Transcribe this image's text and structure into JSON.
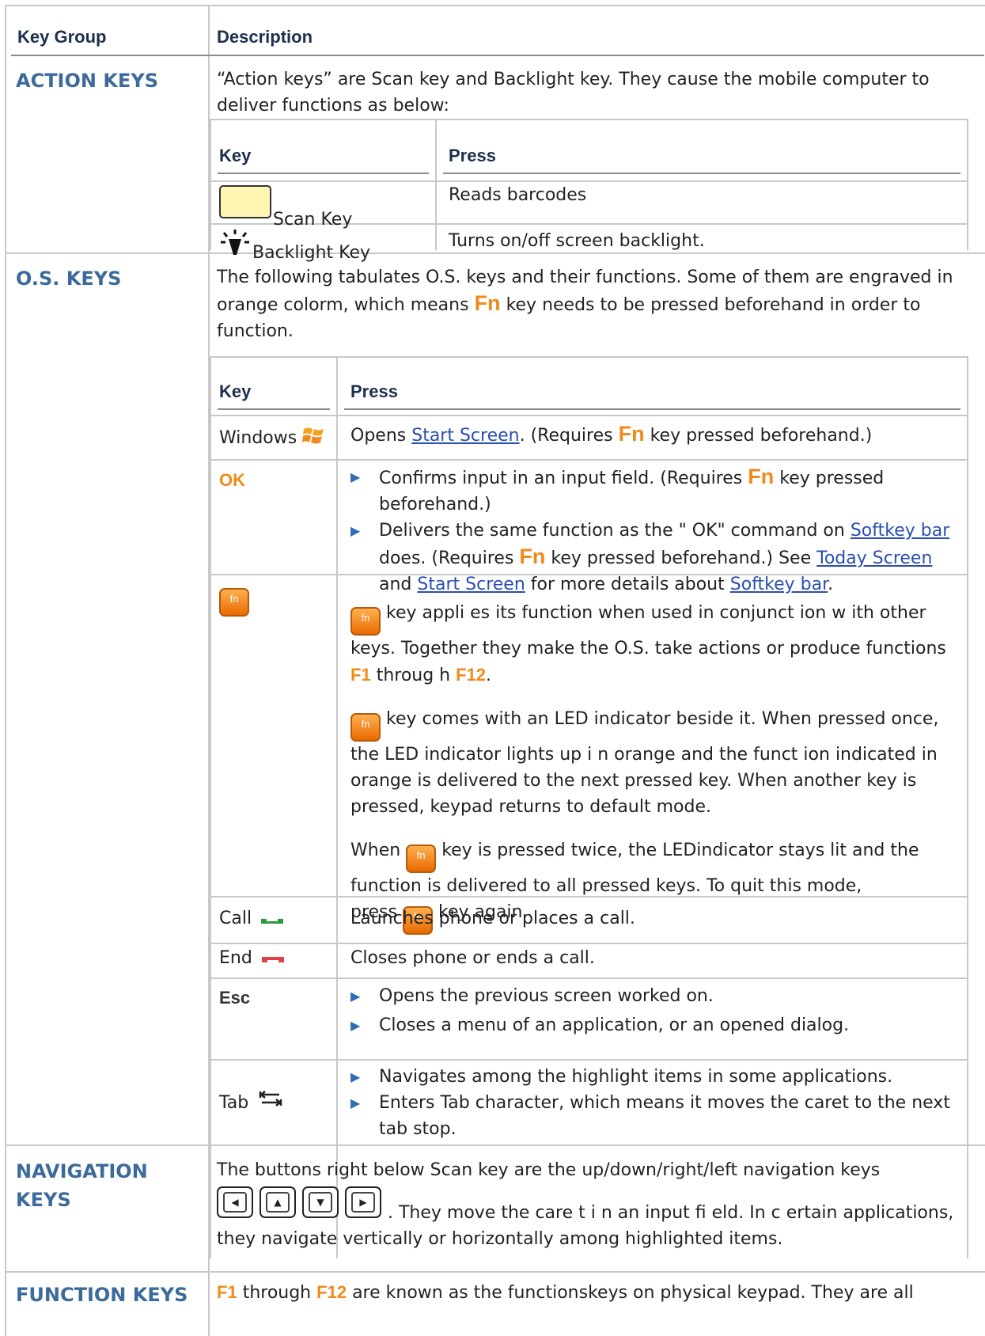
{
  "header": {
    "key_group": "Key Group",
    "description": "Description"
  },
  "inner_header": {
    "key": "Key",
    "press": "Press"
  },
  "action": {
    "group": "ACTION KEYS",
    "intro": "“Action keys” are Scan key and Backlight key. They cause the mobile computer to deliver functions as below:",
    "rows": [
      {
        "key": "Scan Key",
        "press": "Reads barcodes"
      },
      {
        "key": "Backlight Key",
        "press": "Turns on/off screen backlight."
      }
    ]
  },
  "os": {
    "group": "O.S. KEYS",
    "intro_a": "The following tabulates O.S. keys and their functions. Some of them are engraved in orange colorm, which means",
    "fn": "Fn",
    "intro_b": "key needs to be pressed beforehand in order to function.",
    "windows_key": "Windows",
    "windows_a": "Opens",
    "start_screen": "Start Screen",
    "windows_b": ". (Requires",
    "windows_c": "key pressed beforehand.)",
    "ok_key": "OK",
    "ok_b1_a": "Confirms input in an input field. (Requires",
    "ok_b1_b": "key pressed beforehand.)",
    "ok_b2_a": "Delivers the same function as the \"    OK\" command on",
    "softkey_bar": "Softkey bar",
    "ok_b2_b": "does. (Requires",
    "ok_b2_c": "key pressed beforehand.) See",
    "today_screen": "Today Screen",
    "and": "and",
    "ok_b2_d": "for more details about",
    "period": ".",
    "fn_icon": "fn",
    "fn_p1_a": "key appli es its function when used in conjunct ion w ith other keys. Together they make the   O.S. take  actions or produce functions",
    "f1": "F1",
    "through": "throug h",
    "f12": "F12",
    "fn_p2": "key comes with an LED indicator beside it. When pressed once, the LED  indicator lights up i n orange and the funct ion indicated in orange is delivered to the next pressed key. When another key is pressed, keypad returns to default mode.",
    "fn_p3_a": "When",
    "fn_p3_b": "key is pressed twice, the LEDindicator stays lit and the function is delivered to all pressed keys. To quit this mode,",
    "fn_p3_c": "press",
    "fn_p3_d": "key again",
    "call_key": "Call",
    "call_press": "Launches phone or places a call.",
    "end_key": "End",
    "end_press": "Closes phone or ends a call.",
    "esc_key": "Esc",
    "esc_b1": "Opens the previous screen worked on.",
    "esc_b2": "Closes a menu of an application, or an opened dialog.",
    "tab_key": "Tab",
    "tab_b1": "Navigates among the highlight items in some applications.",
    "tab_b2": "Enters Tab character, which means it moves the caret to the next tab stop."
  },
  "navigation": {
    "group": "NAVIGATION KEYS",
    "text_a": "The buttons right below Scan key are the up/down/right/left navigation keys",
    "text_b": ". They move the care  t i n an  input fi eld. In c ertain applications, they navigate vertically or horizontally among highlighted items."
  },
  "function": {
    "group": "FUNCTION KEYS",
    "f1": "F1",
    "through": "through",
    "f12": "F12",
    "text": "are known as the functionskeys on physical keypad. They are all"
  },
  "colors": {
    "group_text": "#3c6a9b",
    "orange": "#f08a1a",
    "link": "#2a4fb0"
  },
  "icons": [
    "backlight-icon",
    "windows-flag-icon",
    "fn-key-icon",
    "call-icon",
    "end-call-icon",
    "tab-icon",
    "left-arrow-key-icon",
    "up-arrow-key-icon",
    "down-arrow-key-icon",
    "right-arrow-key-icon",
    "bullet-arrow-icon"
  ]
}
